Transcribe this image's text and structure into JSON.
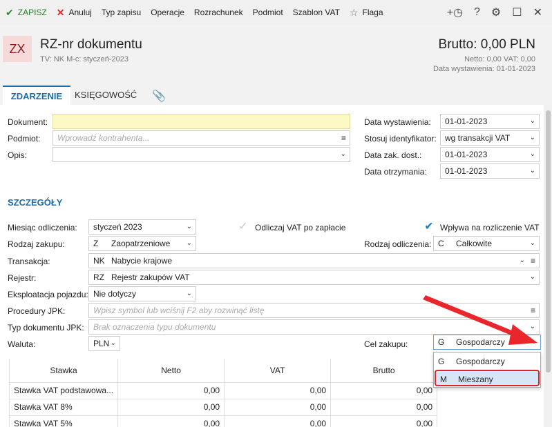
{
  "toolbar": {
    "save": "ZAPISZ",
    "cancel": "Anuluj",
    "type": "Typ zapisu",
    "operations": "Operacje",
    "settlement": "Rozrachunek",
    "subject": "Podmiot",
    "vat_template": "Szablon VAT",
    "flag": "Flaga"
  },
  "header": {
    "badge": "ZX",
    "title": "RZ-nr dokumentu",
    "subtitle": "TV: NK    M-c: styczeń-2023",
    "brutto": "Brutto: 0,00 PLN",
    "netto_vat": "Netto: 0,00 VAT: 0,00",
    "issue_date": "Data wystawienia: 01-01-2023"
  },
  "tabs": {
    "event": "ZDARZENIE",
    "accounting": "KSIĘGOWOŚĆ"
  },
  "form": {
    "document_label": "Dokument:",
    "document_value": "",
    "subject_label": "Podmiot:",
    "subject_placeholder": "Wprowadź kontrahenta...",
    "desc_label": "Opis:",
    "issue_label": "Data wystawienia:",
    "issue_value": "01-01-2023",
    "ident_label": "Stosuj identyfikator:",
    "ident_value": "wg transakcji VAT",
    "delivery_label": "Data zak. dost.:",
    "delivery_value": "01-01-2023",
    "received_label": "Data otrzymania:",
    "received_value": "01-01-2023"
  },
  "details": {
    "section": "SZCZEGÓŁY",
    "month_label": "Miesiąc odliczenia:",
    "month_value": "styczeń 2023",
    "deduct_vat_label": "Odliczaj VAT po zapłacie",
    "affects_label": "Wpływa na rozliczenie VAT",
    "purchase_label": "Rodzaj zakupu:",
    "purchase_code": "Z",
    "purchase_value": "Zaopatrzeniowe",
    "deduction_label": "Rodzaj odliczenia:",
    "deduction_code": "C",
    "deduction_value": "Całkowite",
    "transaction_label": "Transakcja:",
    "transaction_code": "NK",
    "transaction_value": "Nabycie krajowe",
    "register_label": "Rejestr:",
    "register_code": "RZ",
    "register_value": "Rejestr zakupów VAT",
    "vehicle_label": "Eksploatacja pojazdu:",
    "vehicle_value": "Nie dotyczy",
    "jpk_label": "Procedury JPK:",
    "jpk_placeholder": "Wpisz symbol lub wciśnij F2 aby rozwinąć listę",
    "jpk_type_label": "Typ dokumentu JPK:",
    "jpk_type_placeholder": "Brak oznaczenia typu dokumentu",
    "currency_label": "Waluta:",
    "currency_value": "PLN",
    "purpose_label": "Cel zakupu:",
    "purpose_code": "G",
    "purpose_value": "Gospodarczy"
  },
  "purpose_options": [
    {
      "code": "G",
      "label": "Gospodarczy"
    },
    {
      "code": "M",
      "label": "Mieszany"
    }
  ],
  "vat_table": {
    "headers": [
      "Stawka",
      "Netto",
      "VAT",
      "Brutto"
    ],
    "rows": [
      {
        "rate": "Stawka VAT podstawowa...",
        "netto": "0,00",
        "vat": "0,00",
        "brutto": "0,00"
      },
      {
        "rate": "Stawka VAT 8%",
        "netto": "0,00",
        "vat": "0,00",
        "brutto": "0,00"
      },
      {
        "rate": "Stawka VAT 5%",
        "netto": "0,00",
        "vat": "0,00",
        "brutto": "0,00"
      }
    ]
  },
  "colors": {
    "accent": "#1a6ea8",
    "save_green": "#2a8a3a",
    "cancel_red": "#d32f2f",
    "arrow_red": "#e8262c",
    "highlight_border": "#d9262c"
  }
}
